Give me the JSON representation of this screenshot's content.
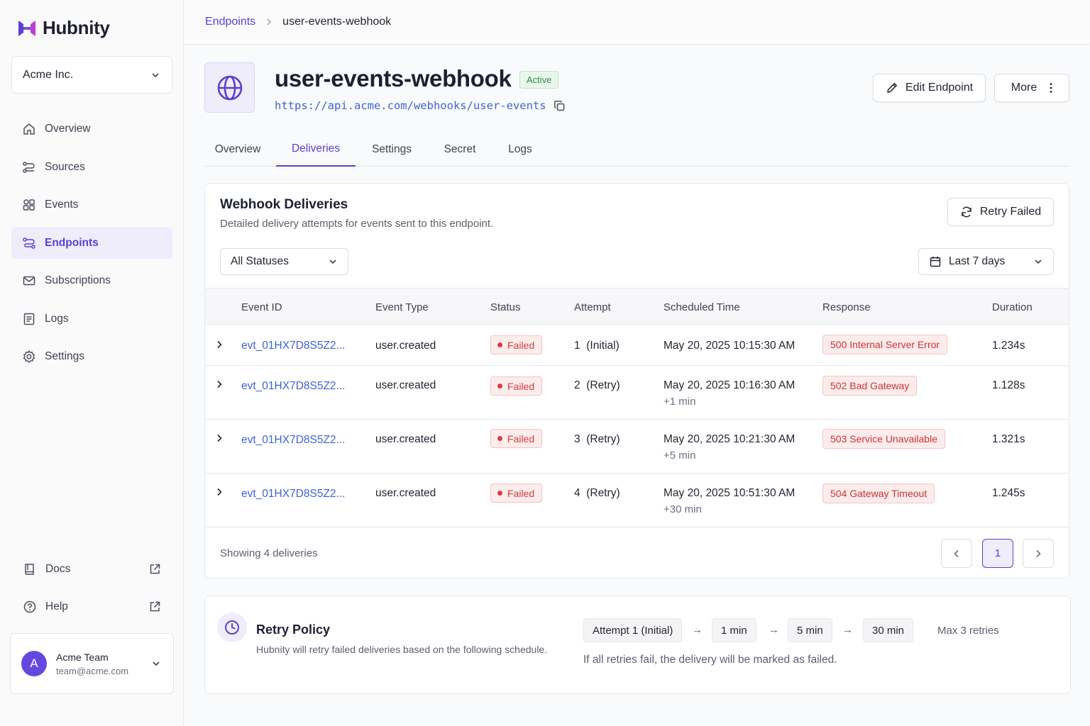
{
  "brand": {
    "name": "Hubnity",
    "accent": "#5b3fd1"
  },
  "org": {
    "name": "Acme Inc."
  },
  "nav": [
    {
      "label": "Overview",
      "icon": "home-icon"
    },
    {
      "label": "Sources",
      "icon": "sources-icon"
    },
    {
      "label": "Events",
      "icon": "events-icon"
    },
    {
      "label": "Endpoints",
      "icon": "endpoints-icon",
      "active": true
    },
    {
      "label": "Subscriptions",
      "icon": "mail-icon"
    },
    {
      "label": "Logs",
      "icon": "logs-icon"
    },
    {
      "label": "Settings",
      "icon": "gear-icon"
    }
  ],
  "nav_bottom": [
    {
      "label": "Docs",
      "icon": "book-icon"
    },
    {
      "label": "Help",
      "icon": "help-icon"
    }
  ],
  "user": {
    "initial": "A",
    "name": "Acme Team",
    "email": "team@acme.com"
  },
  "breadcrumb": {
    "parent": "Endpoints",
    "current": "user-events-webhook"
  },
  "endpoint": {
    "name": "user-events-webhook",
    "status": "Active",
    "url": "https://api.acme.com/webhooks/user-events"
  },
  "actions": {
    "edit": "Edit Endpoint",
    "more": "More"
  },
  "tabs": [
    {
      "label": "Overview"
    },
    {
      "label": "Deliveries",
      "active": true
    },
    {
      "label": "Settings"
    },
    {
      "label": "Secret"
    },
    {
      "label": "Logs"
    }
  ],
  "deliveries": {
    "title": "Webhook Deliveries",
    "subtitle": "Detailed delivery attempts for events sent to this endpoint.",
    "retry_button": "Retry Failed",
    "status_filter": "All Statuses",
    "date_filter": "Last 7 days",
    "columns": [
      "Event ID",
      "Event Type",
      "Status",
      "Attempt",
      "Scheduled Time",
      "Response",
      "Duration"
    ],
    "rows": [
      {
        "event_id": "evt_01HX7D8S5Z2...",
        "event_type": "user.created",
        "status": "Failed",
        "attempt_num": "1",
        "attempt_label": "(Initial)",
        "time": "May 20, 2025 10:15:30 AM",
        "delay": "",
        "response": "500 Internal Server Error",
        "duration": "1.234s"
      },
      {
        "event_id": "evt_01HX7D8S5Z2...",
        "event_type": "user.created",
        "status": "Failed",
        "attempt_num": "2",
        "attempt_label": "(Retry)",
        "time": "May 20, 2025 10:16:30 AM",
        "delay": "+1 min",
        "response": "502 Bad Gateway",
        "duration": "1.128s"
      },
      {
        "event_id": "evt_01HX7D8S5Z2...",
        "event_type": "user.created",
        "status": "Failed",
        "attempt_num": "3",
        "attempt_label": "(Retry)",
        "time": "May 20, 2025 10:21:30 AM",
        "delay": "+5 min",
        "response": "503 Service Unavailable",
        "duration": "1.321s"
      },
      {
        "event_id": "evt_01HX7D8S5Z2...",
        "event_type": "user.created",
        "status": "Failed",
        "attempt_num": "4",
        "attempt_label": "(Retry)",
        "time": "May 20, 2025 10:51:30 AM",
        "delay": "+30 min",
        "response": "504 Gateway Timeout",
        "duration": "1.245s"
      }
    ],
    "footer": "Showing 4 deliveries",
    "page": "1"
  },
  "retry_policy": {
    "title": "Retry Policy",
    "subtitle": "Hubnity will retry failed deliveries based on the following schedule.",
    "steps": [
      "Attempt 1 (Initial)",
      "1 min",
      "5 min",
      "30 min"
    ],
    "arrow": "→",
    "max": "Max 3 retries",
    "note": "If all retries fail, the delivery will be marked as failed."
  }
}
